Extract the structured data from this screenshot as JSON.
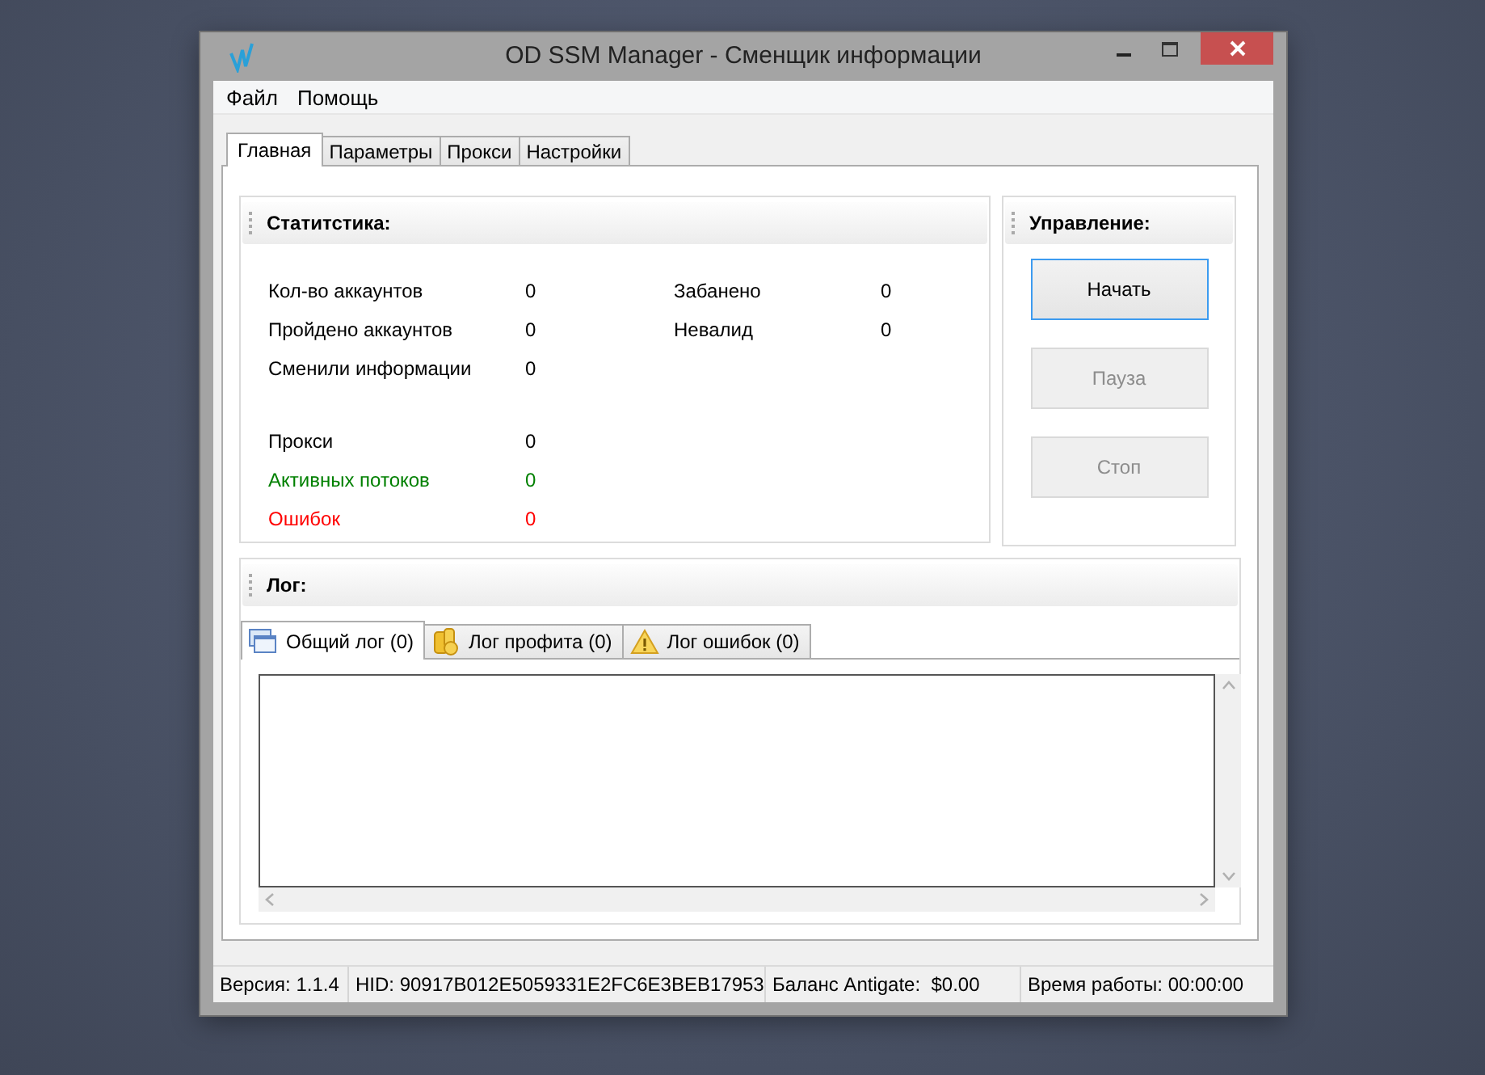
{
  "window": {
    "title": "OD SSM Manager - Сменщик информации"
  },
  "menu": [
    "Файл",
    "Помощь"
  ],
  "tabs": [
    {
      "label": "Главная",
      "selected": true
    },
    {
      "label": "Параметры",
      "selected": false
    },
    {
      "label": "Прокси",
      "selected": false
    },
    {
      "label": "Настройки",
      "selected": false
    }
  ],
  "statistics": {
    "title": "Статитстика:",
    "left_top": [
      {
        "label": "Кол-во аккаунтов",
        "value": "0",
        "color": "#000000"
      },
      {
        "label": "Пройдено аккаунтов",
        "value": "0",
        "color": "#000000"
      },
      {
        "label": "Сменили информации",
        "value": "0",
        "color": "#000000"
      }
    ],
    "left_bottom": [
      {
        "label": "Прокси",
        "value": "0",
        "color": "#000000"
      },
      {
        "label": "Активных потоков",
        "value": "0",
        "color": "#008000"
      },
      {
        "label": "Ошибок",
        "value": "0",
        "color": "#ff0000"
      }
    ],
    "right": [
      {
        "label": "Забанено",
        "value": "0",
        "color": "#000000"
      },
      {
        "label": "Невалид",
        "value": "0",
        "color": "#000000"
      }
    ]
  },
  "control": {
    "title": "Управление:",
    "buttons": [
      {
        "label": "Начать",
        "disabled": false,
        "focused": true
      },
      {
        "label": "Пауза",
        "disabled": true,
        "focused": false
      },
      {
        "label": "Стоп",
        "disabled": true,
        "focused": false
      }
    ]
  },
  "log": {
    "title": "Лог:",
    "tabs": [
      {
        "label": "Общий лог (0)",
        "kind": "windows",
        "selected": true
      },
      {
        "label": "Лог профита (0)",
        "kind": "coins",
        "selected": false
      },
      {
        "label": "Лог ошибок  (0)",
        "kind": "warning",
        "selected": false
      }
    ]
  },
  "status_bar": [
    "Версия: 1.1.4",
    "HID: 90917B012E5059331E2FC6E3BEB17953",
    "Баланс Antigate:  $0.00",
    "Время работы: 00:00:00"
  ]
}
